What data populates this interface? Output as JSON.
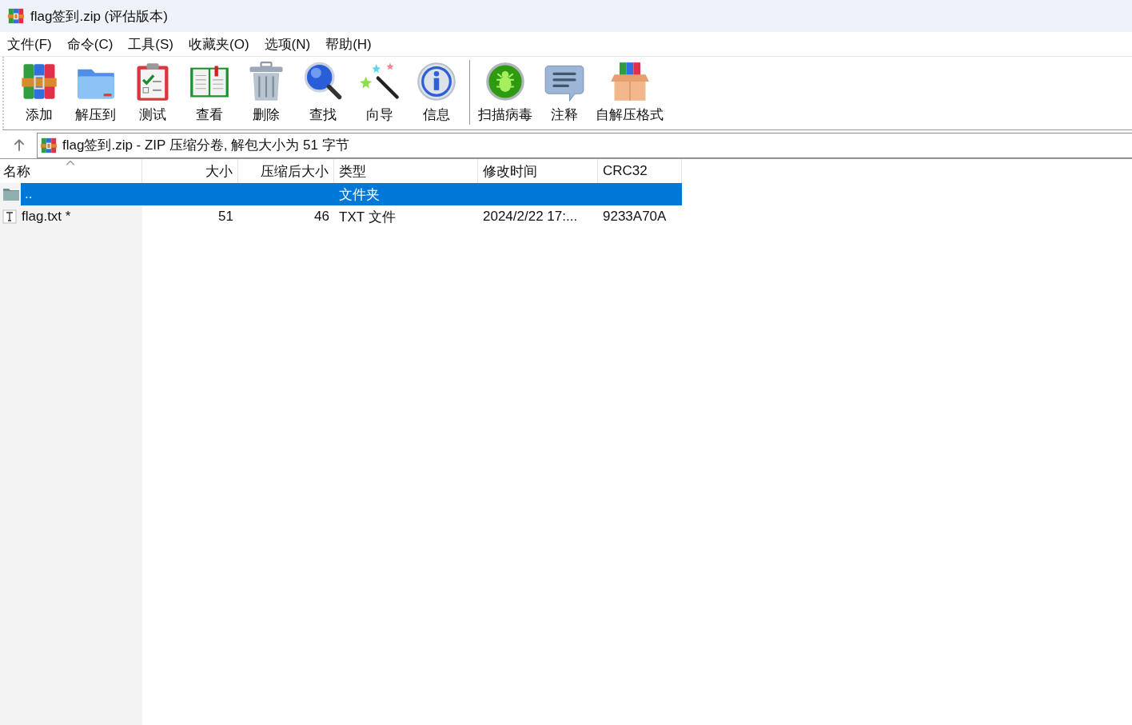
{
  "window": {
    "title": "flag签到.zip (评估版本)"
  },
  "menu": [
    "文件(F)",
    "命令(C)",
    "工具(S)",
    "收藏夹(O)",
    "选项(N)",
    "帮助(H)"
  ],
  "toolbar": [
    {
      "kind": "button",
      "label": "添加"
    },
    {
      "kind": "button",
      "label": "解压到"
    },
    {
      "kind": "button",
      "label": "测试"
    },
    {
      "kind": "button",
      "label": "查看"
    },
    {
      "kind": "button",
      "label": "删除"
    },
    {
      "kind": "button",
      "label": "查找"
    },
    {
      "kind": "button",
      "label": "向导"
    },
    {
      "kind": "button",
      "label": "信息"
    },
    {
      "kind": "separator"
    },
    {
      "kind": "button",
      "label": "扫描病毒"
    },
    {
      "kind": "button",
      "label": "注释"
    },
    {
      "kind": "button",
      "label": "自解压格式"
    }
  ],
  "address": {
    "path": "flag签到.zip - ZIP 压缩分卷, 解包大小为 51 字节"
  },
  "table": {
    "columns": [
      {
        "label": "名称",
        "sorted": true
      },
      {
        "label": "大小",
        "sorted": false
      },
      {
        "label": "压缩后大小",
        "sorted": false
      },
      {
        "label": "类型",
        "sorted": false
      },
      {
        "label": "修改时间",
        "sorted": false
      },
      {
        "label": "CRC32",
        "sorted": false
      }
    ],
    "rows": [
      {
        "kind": "folder",
        "selected": true,
        "cells": [
          "..",
          "",
          "",
          "文件夹",
          "",
          ""
        ]
      },
      {
        "kind": "file",
        "selected": false,
        "cells": [
          "flag.txt *",
          "51",
          "46",
          "TXT 文件",
          "2024/2/22 17:...",
          "9233A70A"
        ]
      }
    ]
  }
}
